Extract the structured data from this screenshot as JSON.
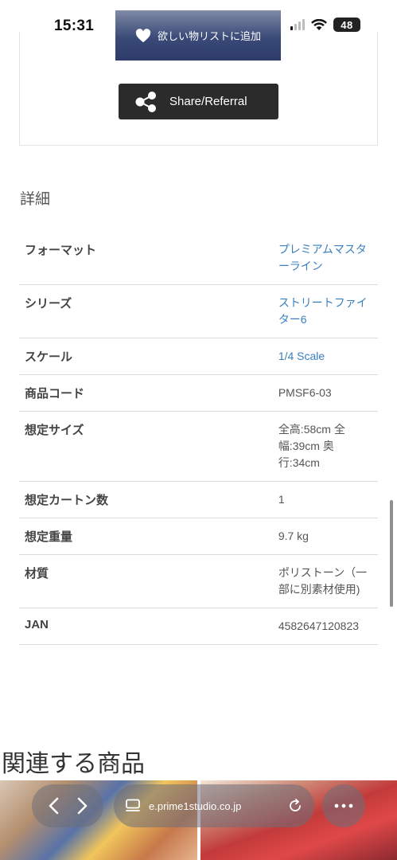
{
  "status": {
    "time": "15:31",
    "battery": "48"
  },
  "wishlist": {
    "label": "欲しい物リストに追加"
  },
  "share": {
    "label": "Share/Referral"
  },
  "details": {
    "heading": "詳細",
    "rows": [
      {
        "label": "フォーマット",
        "value": "プレミアムマスターライン"
      },
      {
        "label": "シリーズ",
        "value": "ストリートファイター6"
      },
      {
        "label": "スケール",
        "value": "1/4 Scale"
      },
      {
        "label": "商品コード",
        "value": "PMSF6-03"
      },
      {
        "label": "想定サイズ",
        "value": "全高:58cm 全幅:39cm 奥行:34cm"
      },
      {
        "label": "想定カートン数",
        "value": "1"
      },
      {
        "label": "想定重量",
        "value": "9.7 kg"
      },
      {
        "label": "材質",
        "value": "ポリストーン（一部に別素材使用)"
      },
      {
        "label": "JAN",
        "value": "4582647120823"
      }
    ]
  },
  "related": {
    "heading": "関連する商品"
  },
  "browser": {
    "url": "e.prime1studio.co.jp"
  },
  "icons": {
    "heart": "heart-icon",
    "share": "share-icon",
    "back": "chevron-left-icon",
    "forward": "chevron-right-icon",
    "tabs": "tabs-icon",
    "reload": "reload-icon",
    "more": "more-icon"
  }
}
